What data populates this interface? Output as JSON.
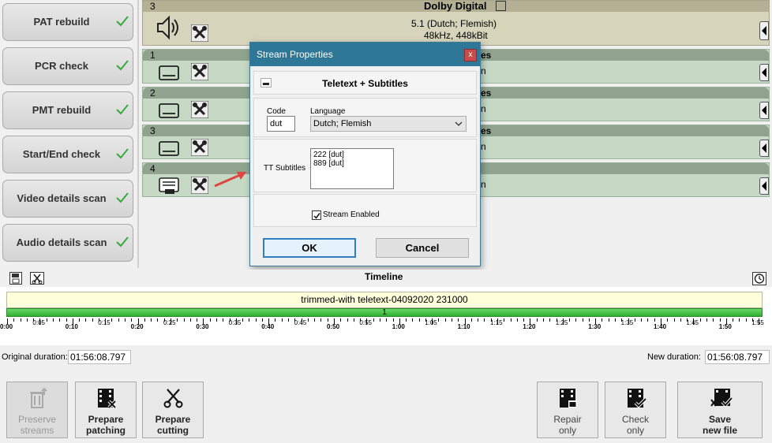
{
  "checks": [
    {
      "label": "PAT rebuild"
    },
    {
      "label": "PCR check"
    },
    {
      "label": "PMT rebuild"
    },
    {
      "label": "Start/End check"
    },
    {
      "label": "Video details scan"
    },
    {
      "label": "Audio details scan"
    }
  ],
  "audio_stream": {
    "index": "3",
    "format": "Dolby Digital",
    "desc": "5.1 (Dutch; Flemish)",
    "rate": "48kHz, 448kBit"
  },
  "subtitle_streams": [
    {
      "index": "1",
      "hdr_fragment": "es",
      "fragment": "n"
    },
    {
      "index": "2",
      "hdr_fragment": "es",
      "fragment": "n"
    },
    {
      "index": "3",
      "hdr_fragment": "es",
      "fragment": "n"
    },
    {
      "index": "4",
      "hdr_fragment": "",
      "fragment": "n"
    }
  ],
  "dialog": {
    "title": "Stream Properties",
    "close": "x",
    "heading": "Teletext + Subtitles",
    "code_label": "Code",
    "code_value": "dut",
    "language_label": "Language",
    "language_value": "Dutch; Flemish",
    "tt_label": "TT Subtitles",
    "tt_items": [
      "222 [dut]",
      "889 [dut]"
    ],
    "enabled_label": "Stream Enabled",
    "enabled": true,
    "ok": "OK",
    "cancel": "Cancel"
  },
  "timeline": {
    "title": "Timeline",
    "clip_name": "trimmed-with teletext-04092020 231000",
    "segment": "1",
    "ticks": [
      "0:00",
      "0:05",
      "0:10",
      "0:15",
      "0:20",
      "0:25",
      "0:30",
      "0:35",
      "0:40",
      "0:45",
      "0:50",
      "0:55",
      "1:00",
      "1:05",
      "1:10",
      "1:15",
      "1:20",
      "1:25",
      "1:30",
      "1:35",
      "1:40",
      "1:45",
      "1:50",
      "1:55"
    ]
  },
  "durations": {
    "original_label": "Original duration:",
    "original_value": "01:56:08.797",
    "new_label": "New duration:",
    "new_value": "01:56:08.797"
  },
  "actions": {
    "preserve": [
      "Preserve",
      "streams"
    ],
    "patching": [
      "Prepare",
      "patching"
    ],
    "cutting": [
      "Prepare",
      "cutting"
    ],
    "repair": [
      "Repair",
      "only"
    ],
    "check": [
      "Check",
      "only"
    ],
    "save": [
      "Save",
      "new file"
    ]
  },
  "colors": {
    "stream_bg": "#c5d9c5",
    "stream_hdr": "#8fa38f",
    "audio_bg": "#d6d4bb",
    "dialog_title": "#2f7796",
    "timeline_green": "#3cc23c"
  }
}
